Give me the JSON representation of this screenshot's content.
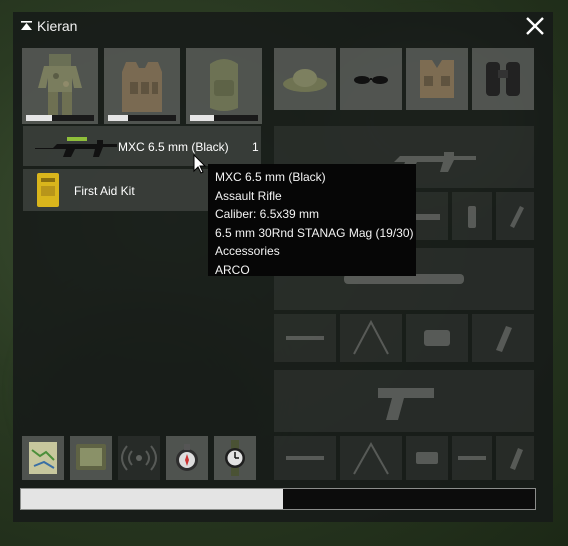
{
  "window": {
    "title": "Kieran"
  },
  "gear_slots": [
    {
      "name": "uniform",
      "fill": 0.38
    },
    {
      "name": "vest",
      "fill": 0.3
    },
    {
      "name": "backpack",
      "fill": 0.35
    }
  ],
  "cargo": [
    {
      "name": "MXC 6.5 mm (Black)",
      "count": "1"
    },
    {
      "name": "First Aid Kit",
      "count": ""
    }
  ],
  "tooltip": {
    "name": "MXC 6.5 mm (Black)",
    "type": "Assault Rifle",
    "caliber": "Caliber: 6.5x39 mm",
    "magazine": "6.5 mm 30Rnd STANAG Mag (19/30)",
    "accessories_label": "Accessories",
    "accessory": "ARCO"
  },
  "load": {
    "fraction": 0.51
  }
}
